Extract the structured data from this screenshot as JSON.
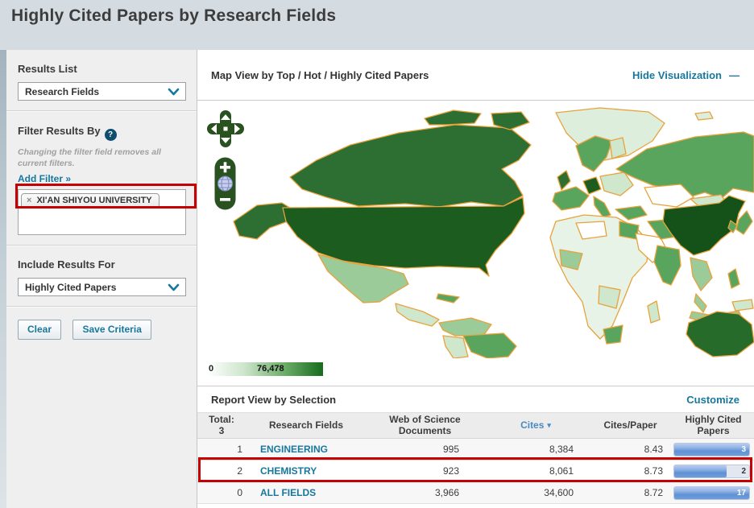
{
  "page": {
    "title": "Highly Cited Papers by Research Fields"
  },
  "colors": {
    "accent_link": "#17789e",
    "sort_header_blue": "#4a8ac2",
    "annotation_red": "#c60000",
    "bar_fill_blue": "#5f91d4",
    "legend_max_green": "#176b1d",
    "map_border_orange": "#e8a23b",
    "header_background": "#d4dbe1"
  },
  "sidebar": {
    "results_list": {
      "label": "Results List",
      "selected": "Research Fields"
    },
    "filter": {
      "heading": "Filter Results By",
      "help_icon": "?",
      "note": "Changing the filter field removes all current filters.",
      "add_filter_label": "Add Filter »",
      "active_filter": {
        "remove_icon": "×",
        "label": "XI'AN SHIYOU UNIVERSITY"
      }
    },
    "include_results": {
      "label": "Include Results For",
      "selected": "Highly Cited Papers"
    },
    "buttons": {
      "clear": "Clear",
      "save": "Save Criteria"
    }
  },
  "visualization": {
    "header": "Map View by Top / Hot / Highly Cited Papers",
    "hide_label": "Hide Visualization",
    "collapse_icon": "—",
    "legend": {
      "min": "0",
      "max": "76,478"
    }
  },
  "report": {
    "header": "Report View by Selection",
    "customize_label": "Customize",
    "columns": {
      "total_line1": "Total:",
      "total_line2": "3",
      "fields": "Research Fields",
      "docs_line1": "Web of Science",
      "docs_line2": "Documents",
      "cites": "Cites",
      "sort_icon": "▾",
      "cites_per_paper": "Cites/Paper",
      "hcp_line1": "Highly Cited",
      "hcp_line2": "Papers"
    },
    "rows": [
      {
        "rank": "1",
        "field": "ENGINEERING",
        "documents": "995",
        "cites": "8,384",
        "cites_per_paper": "8.43",
        "bar": {
          "value": "3",
          "fill_pct": 100,
          "value_color": "#ffffff"
        }
      },
      {
        "rank": "2",
        "field": "CHEMISTRY",
        "documents": "923",
        "cites": "8,061",
        "cites_per_paper": "8.73",
        "bar": {
          "value": "2",
          "fill_pct": 70,
          "value_color": "#333333"
        }
      },
      {
        "rank": "0",
        "field": "ALL FIELDS",
        "documents": "3,966",
        "cites": "34,600",
        "cites_per_paper": "8.72",
        "bar": {
          "value": "17",
          "fill_pct": 100,
          "value_color": "#ffffff"
        }
      }
    ]
  }
}
